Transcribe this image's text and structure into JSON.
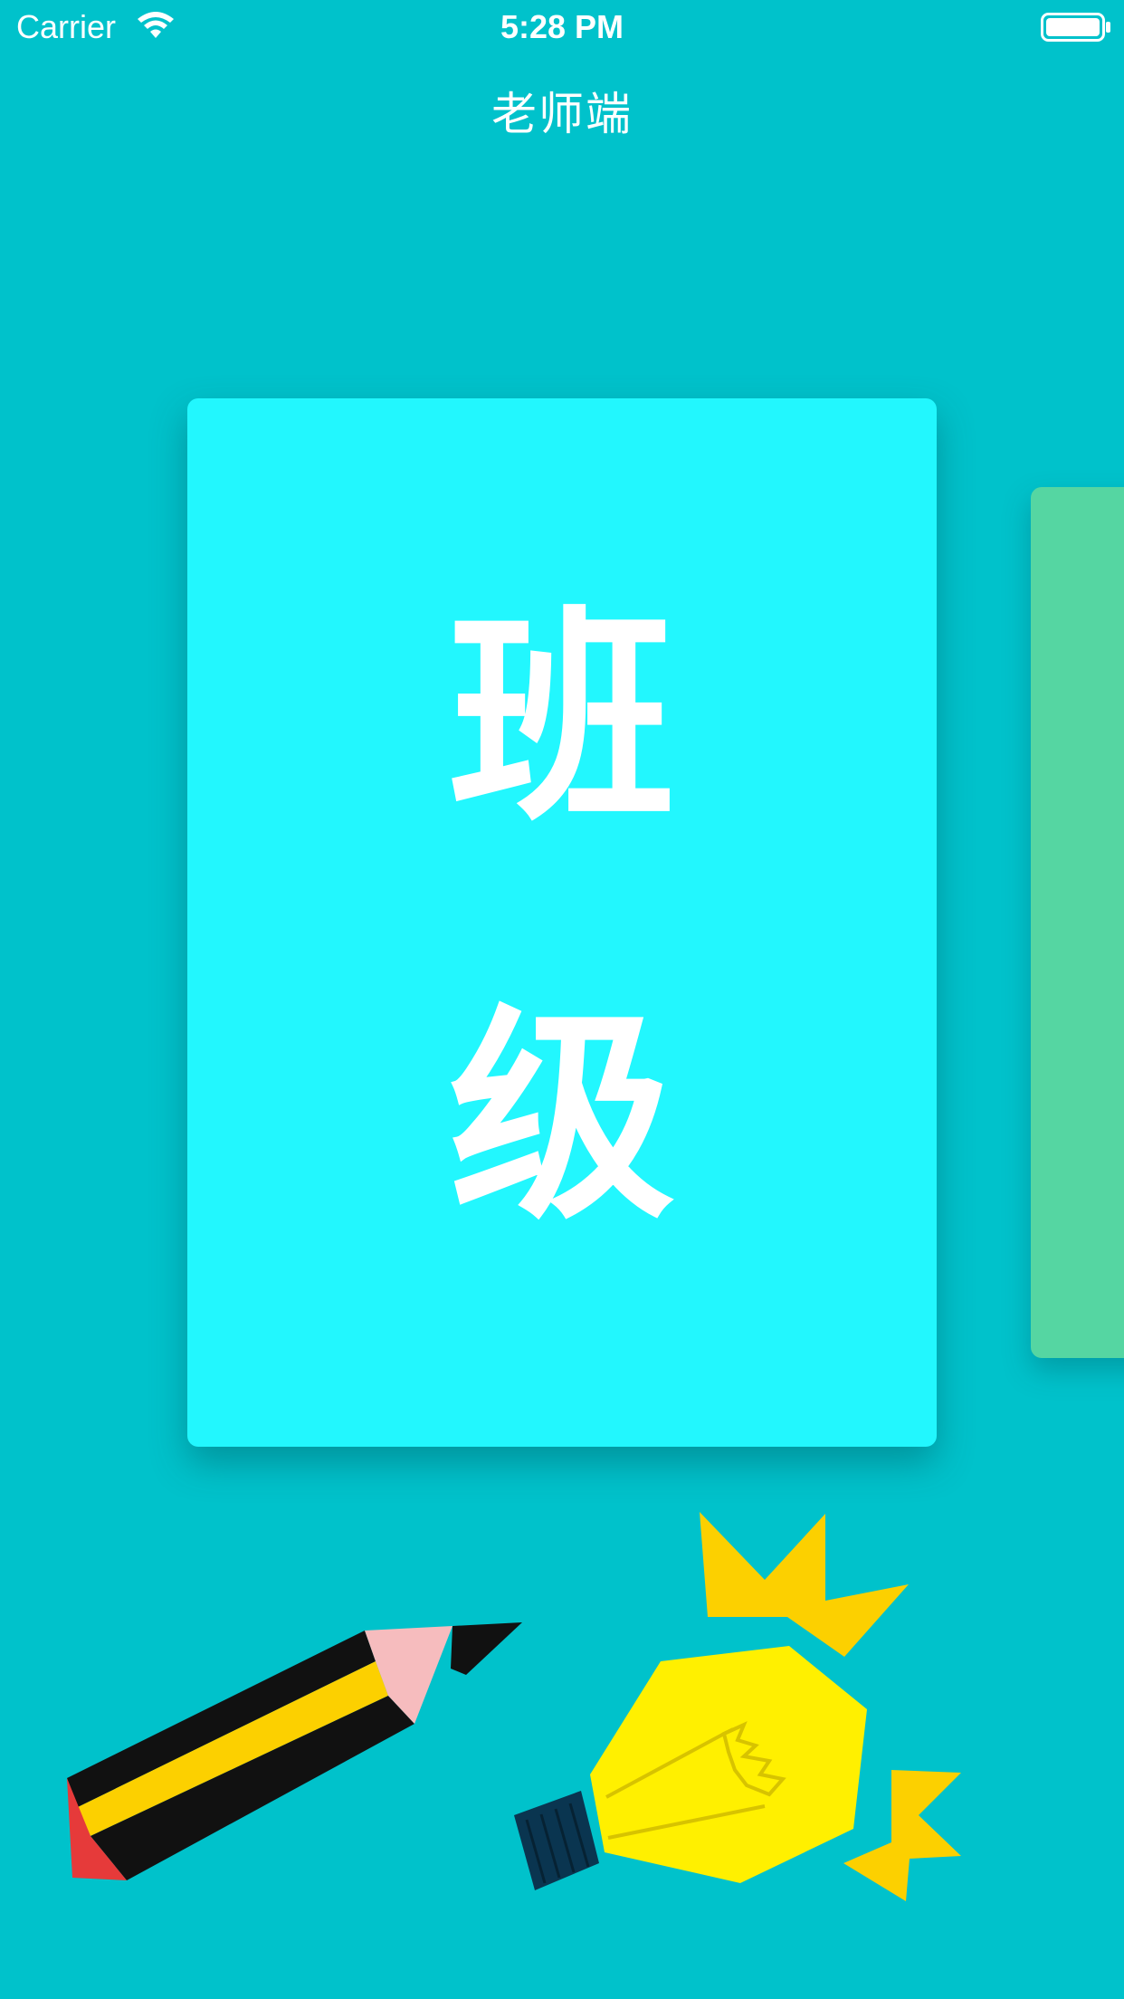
{
  "status_bar": {
    "carrier": "Carrier",
    "time": "5:28 PM",
    "wifi_icon": "wifi-icon",
    "battery_icon": "battery-icon"
  },
  "nav": {
    "title": "老师端"
  },
  "cards": {
    "main": {
      "line1": "班",
      "line2": "级",
      "background": "#22f7fe"
    },
    "next": {
      "background": "#55d6a2"
    }
  },
  "illustrations": {
    "pencil": "pencil-icon",
    "bulb": "lightbulb-icon"
  },
  "colors": {
    "background": "#00c2cb",
    "accent_yellow": "#fcd000",
    "bulb_yellow": "#fff000"
  }
}
